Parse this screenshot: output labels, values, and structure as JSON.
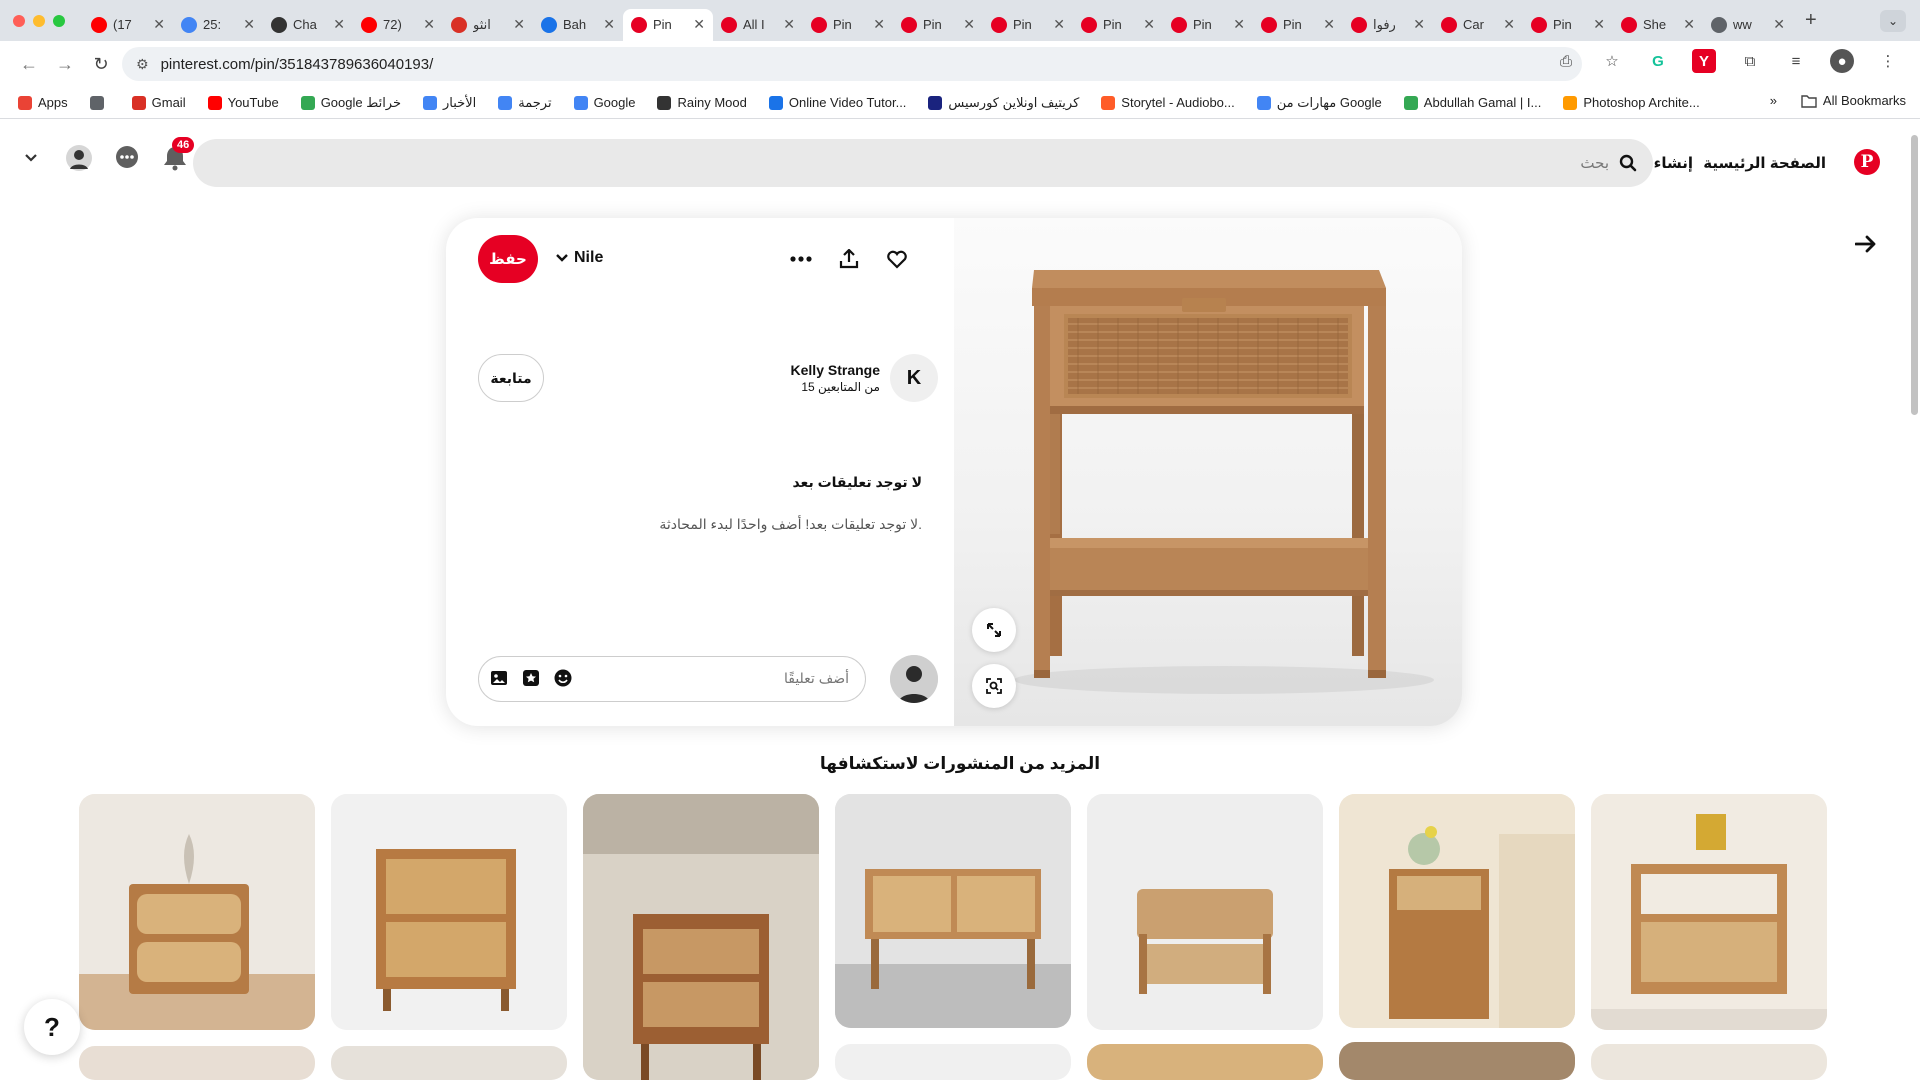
{
  "browser": {
    "tabs": [
      {
        "label": "(17",
        "favicon": "youtube-icon",
        "color": "#ff0000"
      },
      {
        "label": "25:",
        "favicon": "google-icon",
        "color": "#4285f4"
      },
      {
        "label": "Cha",
        "favicon": "chatgpt-icon",
        "color": "#333333"
      },
      {
        "label": "72)",
        "favicon": "youtube-icon",
        "color": "#ff0000"
      },
      {
        "label": "انثو",
        "favicon": "gmail-icon",
        "color": "#d93025"
      },
      {
        "label": "Bah",
        "favicon": "app-icon",
        "color": "#1a73e8"
      },
      {
        "label": "Pin",
        "favicon": "pinterest-icon",
        "color": "#e60023",
        "active": true
      },
      {
        "label": "All I",
        "favicon": "pinterest-icon",
        "color": "#e60023"
      },
      {
        "label": "Pin",
        "favicon": "pinterest-icon",
        "color": "#e60023"
      },
      {
        "label": "Pin",
        "favicon": "pinterest-icon",
        "color": "#e60023"
      },
      {
        "label": "Pin",
        "favicon": "pinterest-icon",
        "color": "#e60023"
      },
      {
        "label": "Pin",
        "favicon": "pinterest-icon",
        "color": "#e60023"
      },
      {
        "label": "Pin",
        "favicon": "pinterest-icon",
        "color": "#e60023"
      },
      {
        "label": "Pin",
        "favicon": "pinterest-icon",
        "color": "#e60023"
      },
      {
        "label": "رفوا",
        "favicon": "pinterest-icon",
        "color": "#e60023"
      },
      {
        "label": "Car",
        "favicon": "pinterest-icon",
        "color": "#e60023"
      },
      {
        "label": "Pin",
        "favicon": "pinterest-icon",
        "color": "#e60023"
      },
      {
        "label": "She",
        "favicon": "pinterest-icon",
        "color": "#e60023"
      },
      {
        "label": "ww",
        "favicon": "globe-icon",
        "color": "#5f6368"
      }
    ],
    "url": "pinterest.com/pin/351843789636040193/",
    "bookmarks": [
      {
        "label": "Apps",
        "icon": "apps-grid-icon",
        "color": "#ea4335"
      },
      {
        "label": "",
        "icon": "grid-icon",
        "color": "#5f6368"
      },
      {
        "label": "Gmail",
        "icon": "gmail-icon",
        "color": "#d93025"
      },
      {
        "label": "YouTube",
        "icon": "youtube-icon",
        "color": "#ff0000"
      },
      {
        "label": "Google خرائط",
        "icon": "maps-icon",
        "color": "#34a853"
      },
      {
        "label": "الأخبار",
        "icon": "news-icon",
        "color": "#4285f4"
      },
      {
        "label": "ترجمة",
        "icon": "translate-icon",
        "color": "#4285f4"
      },
      {
        "label": "Google",
        "icon": "google-icon",
        "color": "#4285f4"
      },
      {
        "label": "Rainy Mood",
        "icon": "rain-icon",
        "color": "#333333"
      },
      {
        "label": "Online Video Tutor...",
        "icon": "video-icon",
        "color": "#1a73e8"
      },
      {
        "label": "كريتيف اونلاين كورسيس",
        "icon": "course-icon",
        "color": "#1a237e"
      },
      {
        "label": "Storytel - Audiobo...",
        "icon": "storytel-icon",
        "color": "#ff5c28"
      },
      {
        "label": "مهارات من Google",
        "icon": "google-icon",
        "color": "#4285f4"
      },
      {
        "label": "Abdullah Gamal | I...",
        "icon": "star-icon",
        "color": "#34a853"
      },
      {
        "label": "Photoshop Archite...",
        "icon": "photoshop-icon",
        "color": "#ff9a00"
      }
    ],
    "bookmarks_more": "»",
    "all_bookmarks": "All Bookmarks"
  },
  "header": {
    "home": "الصفحة الرئيسية",
    "create": "إنشاء",
    "search_placeholder": "بحث",
    "notifications_count": "46",
    "brand_color": "#e60023"
  },
  "pin": {
    "save": "حفظ",
    "board": "Nile",
    "creator_initial": "K",
    "creator_name": "Kelly Strange",
    "followers": "15 من المتابعين",
    "follow": "متابعة",
    "no_comments_title": "لا توجد تعليقات بعد",
    "no_comments_sub": "لا توجد تعليقات بعد! أضف واحدًا لبدء المحادثة.",
    "comment_placeholder": "أضف تعليقًا"
  },
  "more": {
    "title": "المزيد من المنشورات لاستكشافها"
  }
}
